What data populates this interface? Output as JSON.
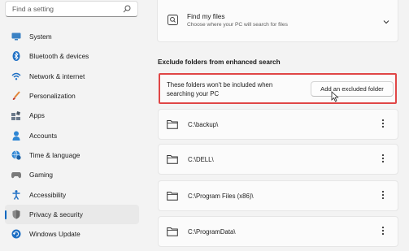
{
  "search": {
    "placeholder": "Find a setting",
    "icon": "search-icon"
  },
  "sidebar": {
    "items": [
      {
        "label": "System",
        "icon": "monitor-icon",
        "active": false
      },
      {
        "label": "Bluetooth & devices",
        "icon": "bluetooth-icon",
        "active": false
      },
      {
        "label": "Network & internet",
        "icon": "wifi-icon",
        "active": false
      },
      {
        "label": "Personalization",
        "icon": "brush-icon",
        "active": false
      },
      {
        "label": "Apps",
        "icon": "apps-icon",
        "active": false
      },
      {
        "label": "Accounts",
        "icon": "person-icon",
        "active": false
      },
      {
        "label": "Time & language",
        "icon": "globe-clock-icon",
        "active": false
      },
      {
        "label": "Gaming",
        "icon": "gamepad-icon",
        "active": false
      },
      {
        "label": "Accessibility",
        "icon": "accessibility-icon",
        "active": false
      },
      {
        "label": "Privacy & security",
        "icon": "shield-icon",
        "active": true
      },
      {
        "label": "Windows Update",
        "icon": "update-icon",
        "active": false
      }
    ]
  },
  "find_my_files": {
    "title": "Find my files",
    "description": "Choose where your PC will search for files"
  },
  "exclude_section": {
    "title": "Exclude folders from enhanced search",
    "description": "These folders won't be included when searching your PC",
    "button_label": "Add an excluded folder"
  },
  "folders": [
    {
      "path": "C:\\backup\\"
    },
    {
      "path": "C:\\DELL\\"
    },
    {
      "path": "C:\\Program Files (x86)\\"
    },
    {
      "path": "C:\\ProgramData\\"
    }
  ],
  "colors": {
    "accent": "#0067c0",
    "highlight_border": "#e04646"
  }
}
